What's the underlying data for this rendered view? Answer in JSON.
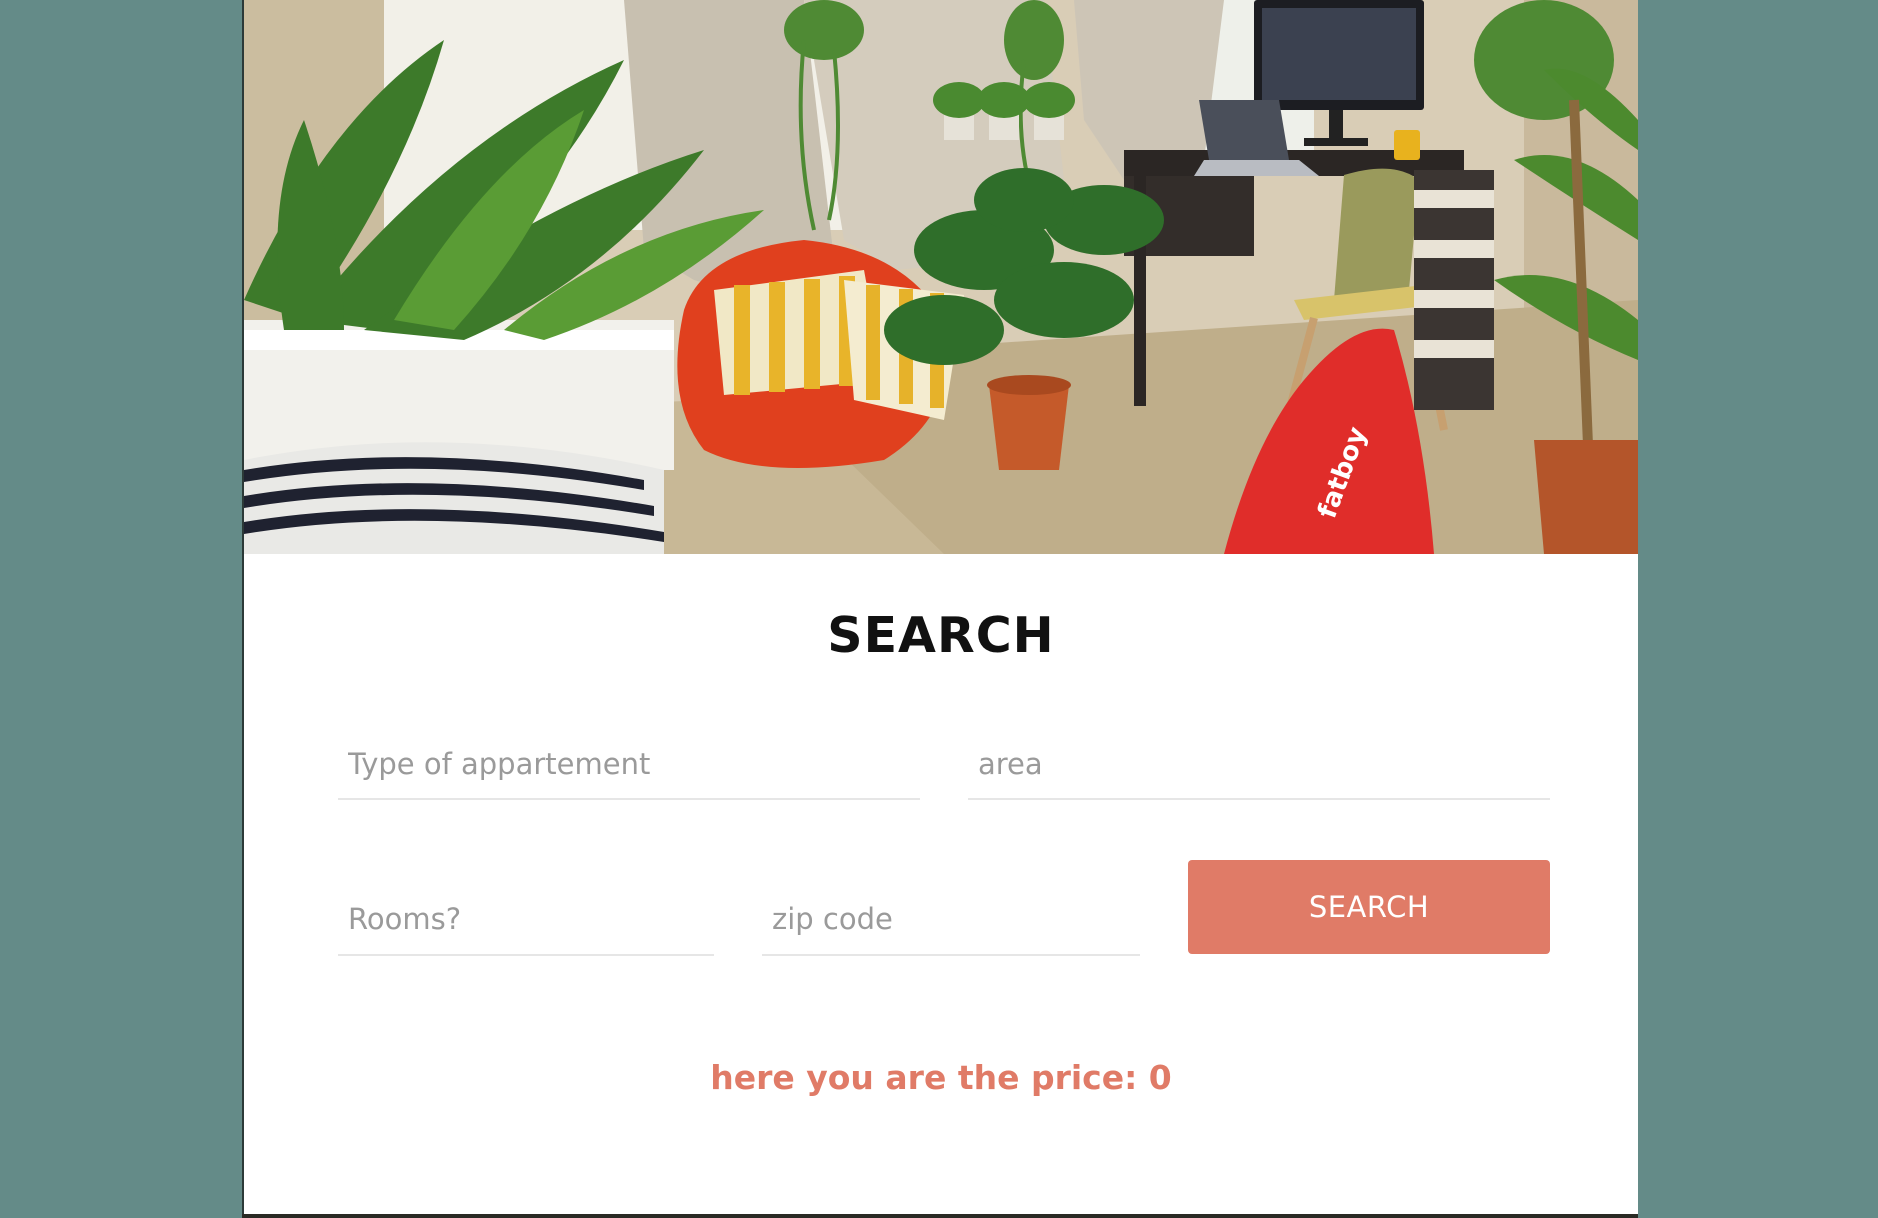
{
  "hero": {
    "image": "interior-room-with-plants-photo",
    "bag_label": "fatboy"
  },
  "search": {
    "title": "SEARCH",
    "type_placeholder": "Type of appartement",
    "area_placeholder": "area",
    "rooms_placeholder": "Rooms?",
    "zip_placeholder": "zip code",
    "button_label": "SEARCH"
  },
  "result": {
    "text": "here you are the price: 0"
  },
  "colors": {
    "background": "#648b88",
    "accent": "#e07b67",
    "panel": "#ffffff"
  }
}
